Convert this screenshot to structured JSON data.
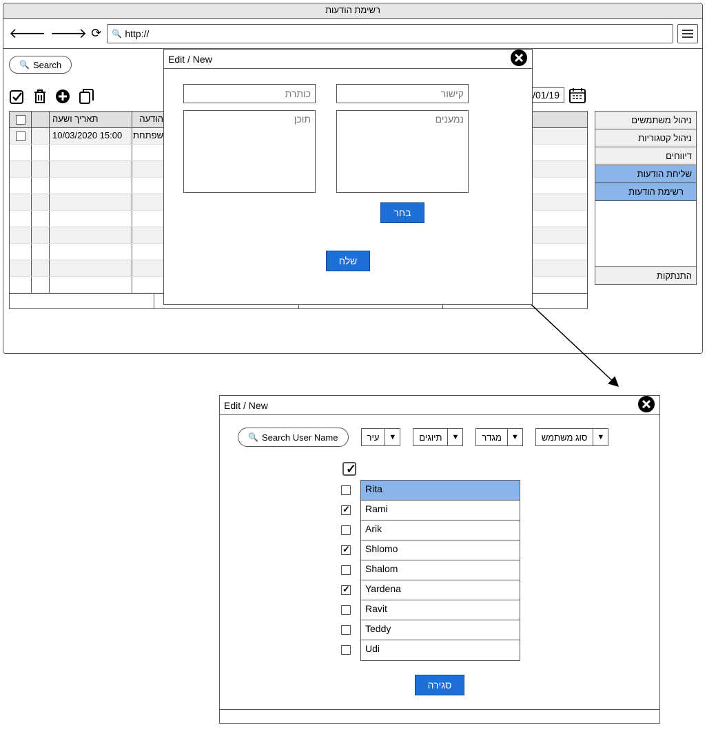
{
  "window": {
    "title": "רשימת הודעות"
  },
  "browser": {
    "url_prefix": "http://"
  },
  "search": {
    "placeholder": "Search"
  },
  "date": {
    "visible": "/01/19"
  },
  "sidebar": {
    "items": [
      {
        "label": "ניהול משתמשים"
      },
      {
        "label": "ניהול קטגוריות"
      },
      {
        "label": "דיווחים"
      },
      {
        "label": "שליחת הודעות"
      },
      {
        "label": "רשימת הודעות"
      },
      {
        "label": "התנתקות"
      }
    ]
  },
  "table": {
    "headers": {
      "date": "תאריך ושעה",
      "status": "הודעה"
    },
    "rows": [
      {
        "date": "10/03/2020 15:00",
        "status": "שפתחת"
      }
    ]
  },
  "modal1": {
    "title": "Edit / New",
    "fields": {
      "subject_placeholder": "כותרת",
      "body_placeholder": "תוכן",
      "link_placeholder": "קישור",
      "recipients_placeholder": "נמענים"
    },
    "buttons": {
      "choose": "בחר",
      "send": "שלח"
    }
  },
  "modal2": {
    "title": "Edit / New",
    "search_placeholder": "Search User Name",
    "filters": {
      "city": "עיר",
      "tags": "תיוגים",
      "gender": "מגדר",
      "usertype": "סוג משתמש"
    },
    "users": [
      {
        "name": "Rita",
        "checked": false,
        "selected": true
      },
      {
        "name": "Rami",
        "checked": true,
        "selected": false
      },
      {
        "name": "Arik",
        "checked": false,
        "selected": false
      },
      {
        "name": "Shlomo",
        "checked": true,
        "selected": false
      },
      {
        "name": "Shalom",
        "checked": false,
        "selected": false
      },
      {
        "name": "Yardena",
        "checked": true,
        "selected": false
      },
      {
        "name": "Ravit",
        "checked": false,
        "selected": false
      },
      {
        "name": "Teddy",
        "checked": false,
        "selected": false
      },
      {
        "name": "Udi",
        "checked": false,
        "selected": false
      }
    ],
    "master_checked": true,
    "buttons": {
      "close": "סגירה"
    }
  }
}
